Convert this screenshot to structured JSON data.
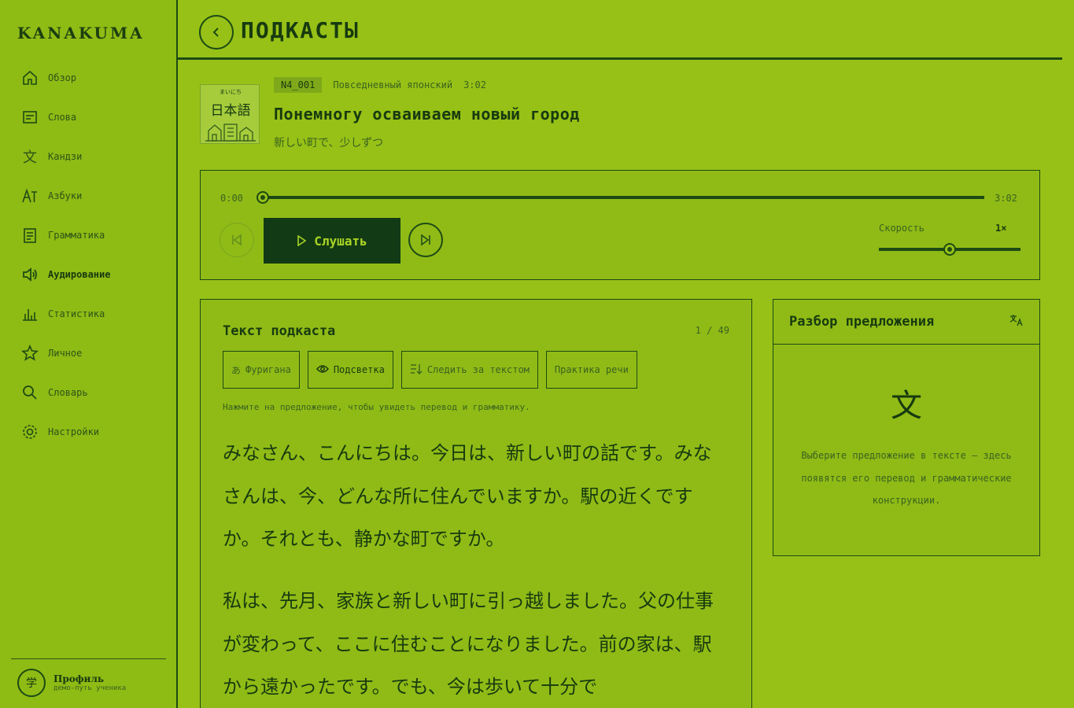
{
  "app": {
    "logo": "KANAKUMA"
  },
  "sidebar": {
    "items": [
      {
        "label": "Обзор",
        "icon": "home-icon"
      },
      {
        "label": "Слова",
        "icon": "card-icon"
      },
      {
        "label": "Кандзи",
        "icon": "kanji-icon"
      },
      {
        "label": "Азбуки",
        "icon": "kana-icon"
      },
      {
        "label": "Грамматика",
        "icon": "doc-icon"
      },
      {
        "label": "Аудирование",
        "icon": "speaker-icon",
        "active": true
      },
      {
        "label": "Статистика",
        "icon": "chart-icon"
      },
      {
        "label": "Личное",
        "icon": "star-icon"
      },
      {
        "label": "Словарь",
        "icon": "search-icon"
      },
      {
        "label": "Настройки",
        "icon": "gear-icon"
      }
    ],
    "profile": {
      "avatar": "学",
      "name": "Профиль",
      "sub": "демо-путь ученика"
    }
  },
  "header": {
    "title": "ПОДКАСТЫ"
  },
  "episode": {
    "cover_small": "まいにち",
    "cover_big": "日本語",
    "code": "N4_001",
    "category": "Повседневный японский",
    "duration": "3:02",
    "title": "Понемногу осваиваем новый город",
    "subtitle": "新しい町で、少しずつ"
  },
  "player": {
    "time_current": "0:00",
    "time_total": "3:02",
    "progress": 0,
    "play_label": "Слушать",
    "speed_label": "Скорость",
    "speed_value": "1×",
    "speed_fraction": 0.5
  },
  "transcript": {
    "title": "Текст подкаста",
    "counter": "1 / 49",
    "tools": [
      {
        "label": "Фуригана",
        "icon": "あ"
      },
      {
        "label": "Подсветка",
        "icon": "eye-icon"
      },
      {
        "label": "Следить за текстом",
        "icon": "follow-icon"
      },
      {
        "label": "Практика речи",
        "icon": ""
      }
    ],
    "hint": "Нажмите на предложение, чтобы увидеть перевод и грамматику.",
    "paragraphs": [
      "みなさん、こんにちは。今日は、新しい町の話です。みなさんは、今、どんな所に住んでいますか。駅の近くですか。それとも、静かな町ですか。",
      "私は、先月、家族と新しい町に引っ越しました。父の仕事が変わって、ここに住むことになりました。前の家は、駅から遠かったです。でも、今は歩いて十分で"
    ]
  },
  "analysis": {
    "title": "Разбор предложения",
    "icon": "translate-icon",
    "glyph": "文",
    "text": "Выберите предложение в тексте — здесь появятся его перевод и грамматические конструкции."
  }
}
